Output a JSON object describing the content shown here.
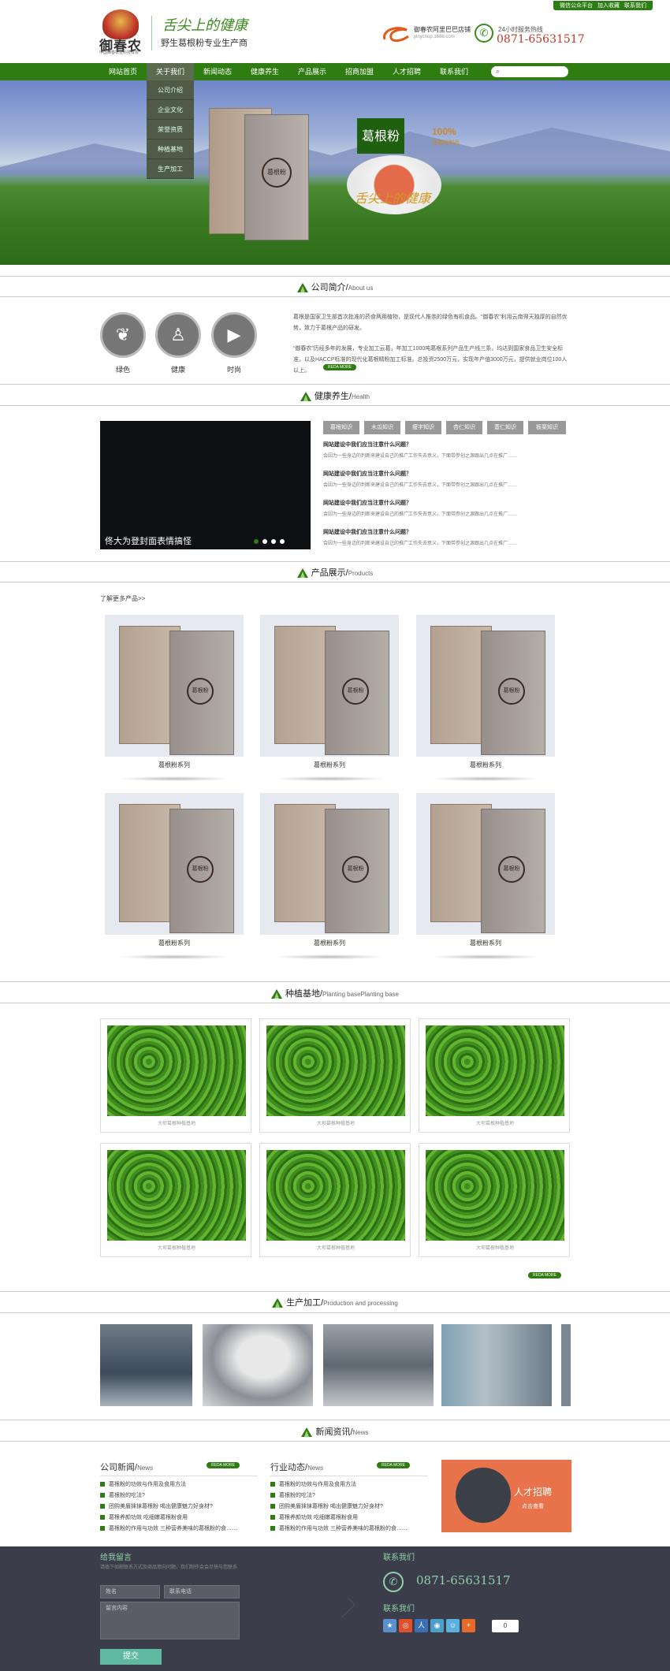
{
  "topbar": {
    "links": [
      "微信公众平台",
      "加入收藏",
      "联系我们"
    ]
  },
  "header": {
    "logo_text": "御春农",
    "logo_sub": "中国御春农业科技有限",
    "slogan_main": "舌尖上的健康",
    "slogan_sub": "野生葛根粉专业生产商",
    "shop_title": "御春农阿里巴巴店铺",
    "shop_url": "yinycnop.1688.com",
    "hotline_label": "24小时服务热线",
    "hotline": "0871-65631517"
  },
  "nav": {
    "items": [
      "网站首页",
      "关于我们",
      "新闻动态",
      "健康养生",
      "产品展示",
      "招商加盟",
      "人才招聘",
      "联系我们"
    ],
    "search_placeholder": ""
  },
  "dropdown": {
    "items": [
      "公司介绍",
      "企业文化",
      "荣誉资质",
      "种植基地",
      "生产加工"
    ]
  },
  "banner": {
    "badge": "葛根粉",
    "percent": "100%",
    "percent_sub": "纯葛根制品",
    "brush_text": "舌尖上的健康",
    "box_seal": "葛根粉"
  },
  "sections": {
    "about": {
      "title": "公司简介/",
      "en": "About us"
    },
    "health": {
      "title": "健康养生/",
      "en": "Health"
    },
    "products": {
      "title": "产品展示/",
      "en": "Products"
    },
    "base": {
      "title": "种植基地/",
      "en": "Planting basePlanting base"
    },
    "production": {
      "title": "生产加工/",
      "en": "Production and processing"
    },
    "news": {
      "title": "新闻资讯/",
      "en": "News"
    }
  },
  "about": {
    "icons": [
      {
        "icon": "leaf-icon",
        "label": "绿色"
      },
      {
        "icon": "body-icon",
        "label": "健康"
      },
      {
        "icon": "camera-icon",
        "label": "时尚"
      }
    ],
    "p1": "葛根是国家卫生部首次批准的药食两用植物，是现代人推崇的绿色有机食品。“御春农”利用云南得天独厚的自然优势，致力于葛根产品的研发。",
    "p2": "“御春农”历经多年的发展，专业加工云葛，年加工1000吨葛根系列产品生产线三条，均达到国家食品卫生安全标准，以及HACCP标准的现代化葛根精粉加工标准。总投资2500万元，实现年产值3000万元，提供就业岗位100人以上。",
    "more": "REDA MORE"
  },
  "health": {
    "video_caption": "佟大为登封面表情搞怪",
    "tabs": [
      "葛根知识",
      "木瓜知识",
      "瘦字知识",
      "杏仁知识",
      "薏仁知识",
      "板栗知识"
    ],
    "items": [
      {
        "q": "网站建设中我们应当注意什么问题？",
        "a": "会因为一些身边的判断来建设自己的推广工作失去意义，下面带参创之源跟出几点在推广……"
      },
      {
        "q": "网站建设中我们应当注意什么问题？",
        "a": "会因为一些身边的判断来建设自己的推广工作失去意义，下面带参创之源跟出几点在推广……"
      },
      {
        "q": "网站建设中我们应当注意什么问题？",
        "a": "会因为一些身边的判断来建设自己的推广工作失去意义，下面带参创之源跟出几点在推广……"
      },
      {
        "q": "网站建设中我们应当注意什么问题？",
        "a": "会因为一些身边的判断来建设自己的推广工作失去意义，下面带参创之源跟出几点在推广……"
      }
    ]
  },
  "products": {
    "more_link": "了解更多产品>>",
    "items": [
      {
        "label": "葛根粉系列"
      },
      {
        "label": "葛根粉系列"
      },
      {
        "label": "葛根粉系列"
      },
      {
        "label": "葛根粉系列"
      },
      {
        "label": "葛根粉系列"
      },
      {
        "label": "葛根粉系列"
      }
    ],
    "seal": "葛根粉"
  },
  "base": {
    "items": [
      {
        "label": "大坝葛根种植基地"
      },
      {
        "label": "大坝葛根种植基地"
      },
      {
        "label": "大坝葛根种植基地"
      },
      {
        "label": "大坝葛根种植基地"
      },
      {
        "label": "大坝葛根种植基地"
      },
      {
        "label": "大坝葛根种植基地"
      }
    ],
    "more": "REDA MORE"
  },
  "news": {
    "company": {
      "title": "公司新闻/",
      "en": "News",
      "more": "REDA MORE",
      "items": [
        "葛根粉的功效与作用及食用方法",
        "葛根粉的吃法?",
        "团购美眉抹抹葛根粉 喝出健康魅力好身材?",
        "葛根养颜功效 吃细嫩葛根粉食用",
        "葛根粉的作用与功效 三种营养美味的葛根粉的食……"
      ]
    },
    "industry": {
      "title": "行业动态/",
      "en": "News",
      "more": "REDA MORE",
      "items": [
        "葛根粉的功效与作用及食用方法",
        "葛根粉的吃法?",
        "团购美眉抹抹葛根粉 喝出健康魅力好身材?",
        "葛根养颜功效 吃细嫩葛根粉食用",
        "葛根粉的作用与功效 三种营养美味的葛根粉的食……"
      ]
    },
    "recruit_title": "人才招聘",
    "recruit_sub": "点击查看"
  },
  "footer": {
    "msg_title": "给我留言",
    "msg_desc": "请填下如邮联系方式及商品意向问题，我们制作会会尽快与您联系",
    "name_ph": "姓名",
    "phone_ph": "联系电话",
    "content_ph": "留言内容",
    "submit": "提交",
    "contact_title": "联系我们",
    "phone": "0871-65631517",
    "share_title": "联系我们",
    "share_count": "0"
  },
  "colors": {
    "brand_green": "#2f7d12",
    "hotline_red": "#c0392b",
    "footer_bg": "#3b3d4a"
  }
}
